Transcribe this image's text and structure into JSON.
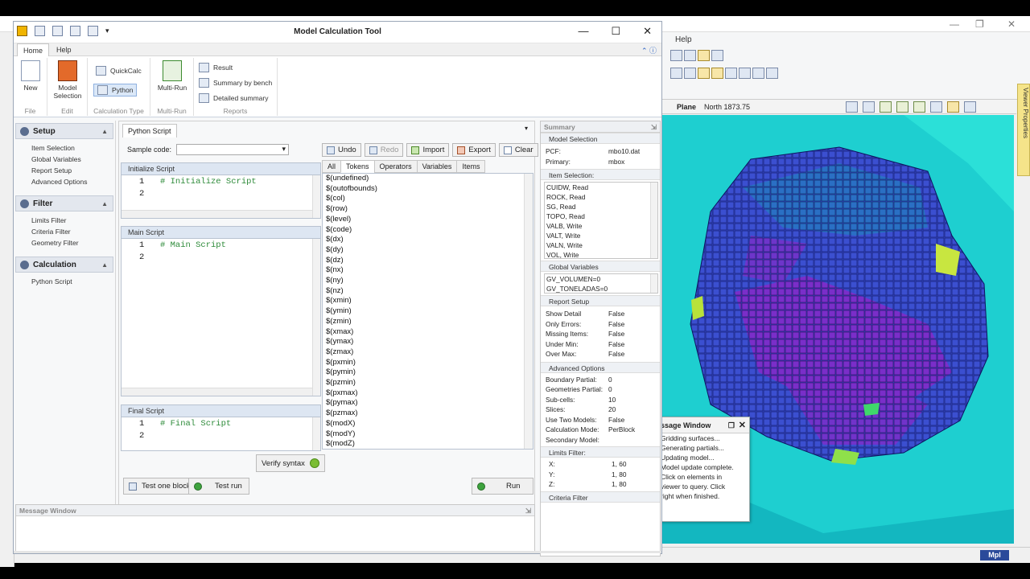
{
  "background": {
    "help_label": "Help",
    "viewer_bar": {
      "plane_label": "Plane",
      "plane_value": "North 1873.75"
    },
    "side_tab": "Viewer Properties",
    "status_mpl": "Mpl",
    "message_window": {
      "title": "ssage Window",
      "lines": [
        "Gridding surfaces...",
        "Generating partials...",
        "Updating model...",
        "Model update complete.",
        "Click on elements in",
        "viewer to query.  Click",
        "right when finished."
      ]
    }
  },
  "dialog": {
    "title": "Model Calculation Tool",
    "tabs": {
      "home": "Home",
      "help": "Help"
    },
    "ribbon": {
      "new": "New",
      "model_selection": "Model Selection",
      "quickcalc": "QuickCalc",
      "python": "Python",
      "multirun": "Multi-Run",
      "result": "Result",
      "summary_by_bench": "Summary by bench",
      "detailed_summary": "Detailed summary",
      "groups": {
        "file": "File",
        "edit": "Edit",
        "calc_type": "Calculation Type",
        "multirun": "Multi-Run",
        "reports": "Reports"
      }
    },
    "nav": {
      "setup": {
        "title": "Setup",
        "items": [
          "Item Selection",
          "Global Variables",
          "Report Setup",
          "Advanced Options"
        ]
      },
      "filter": {
        "title": "Filter",
        "items": [
          "Limits Filter",
          "Criteria Filter",
          "Geometry Filter"
        ]
      },
      "calculation": {
        "title": "Calculation",
        "items": [
          "Python Script"
        ]
      }
    },
    "center": {
      "tab": "Python Script",
      "sample_label": "Sample code:",
      "sample_value": "",
      "buttons": {
        "undo": "Undo",
        "redo": "Redo",
        "import": "Import",
        "export": "Export",
        "clear": "Clear"
      },
      "init": {
        "title": "Initialize Script",
        "lines": [
          {
            "n": "1",
            "t": "# Initialize Script"
          },
          {
            "n": "2",
            "t": ""
          }
        ]
      },
      "main": {
        "title": "Main Script",
        "lines": [
          {
            "n": "1",
            "t": "# Main Script"
          },
          {
            "n": "2",
            "t": ""
          }
        ]
      },
      "final": {
        "title": "Final Script",
        "lines": [
          {
            "n": "1",
            "t": "# Final Script"
          },
          {
            "n": "2",
            "t": ""
          }
        ]
      },
      "token_tabs": [
        "All",
        "Tokens",
        "Operators",
        "Variables",
        "Items"
      ],
      "tokens": [
        "$(undefined)",
        "$(outofbounds)",
        "$(col)",
        "$(row)",
        "$(level)",
        "$(code)",
        "$(dx)",
        "$(dy)",
        "$(dz)",
        "$(nx)",
        "$(ny)",
        "$(nz)",
        "$(xmin)",
        "$(ymin)",
        "$(zmin)",
        "$(xmax)",
        "$(ymax)",
        "$(zmax)",
        "$(pxmin)",
        "$(pymin)",
        "$(pzmin)",
        "$(pxmax)",
        "$(pymax)",
        "$(pzmax)",
        "$(modX)",
        "$(modY)",
        "$(modZ)"
      ],
      "verify": "Verify syntax",
      "test_one_block": "Test one block",
      "test_run": "Test run",
      "run": "Run"
    },
    "summary": {
      "title": "Summary",
      "model_selection": {
        "header": "Model Selection",
        "rows": [
          {
            "k": "PCF:",
            "v": "mbo10.dat"
          },
          {
            "k": "Primary:",
            "v": "mbox"
          }
        ]
      },
      "item_selection": {
        "header": "Item Selection:",
        "items": [
          "CUIDW, Read",
          "ROCK, Read",
          "SG, Read",
          "TOPO, Read",
          "VALB, Write",
          "VALT, Write",
          "VALN, Write",
          "VOL, Write"
        ]
      },
      "global_variables": {
        "header": "Global Variables",
        "items": [
          "GV_VOLUMEN=0",
          "GV_TONELADAS=0"
        ]
      },
      "report_setup": {
        "header": "Report Setup",
        "rows": [
          {
            "k": "Show Detail",
            "v": "False"
          },
          {
            "k": "Only Errors:",
            "v": "False"
          },
          {
            "k": "Missing Items:",
            "v": "False"
          },
          {
            "k": "Under Min:",
            "v": "False"
          },
          {
            "k": "Over Max:",
            "v": "False"
          }
        ]
      },
      "advanced": {
        "header": "Advanced Options",
        "rows": [
          {
            "k": "Boundary Partial:",
            "v": "0"
          },
          {
            "k": "Geometries Partial:",
            "v": "0"
          },
          {
            "k": "Sub-cells:",
            "v": "10"
          },
          {
            "k": "Slices:",
            "v": "20"
          },
          {
            "k": "Use Two Models:",
            "v": "False"
          },
          {
            "k": "Calculation Mode:",
            "v": "PerBlock"
          },
          {
            "k": "Secondary Model:",
            "v": ""
          }
        ]
      },
      "limits": {
        "header": "Limits Filter:",
        "rows": [
          {
            "k": "X:",
            "v": "1, 60"
          },
          {
            "k": "Y:",
            "v": "1, 80"
          },
          {
            "k": "Z:",
            "v": "1, 80"
          }
        ]
      },
      "criteria": {
        "header": "Criteria Filter"
      }
    },
    "message_window": "Message Window"
  }
}
